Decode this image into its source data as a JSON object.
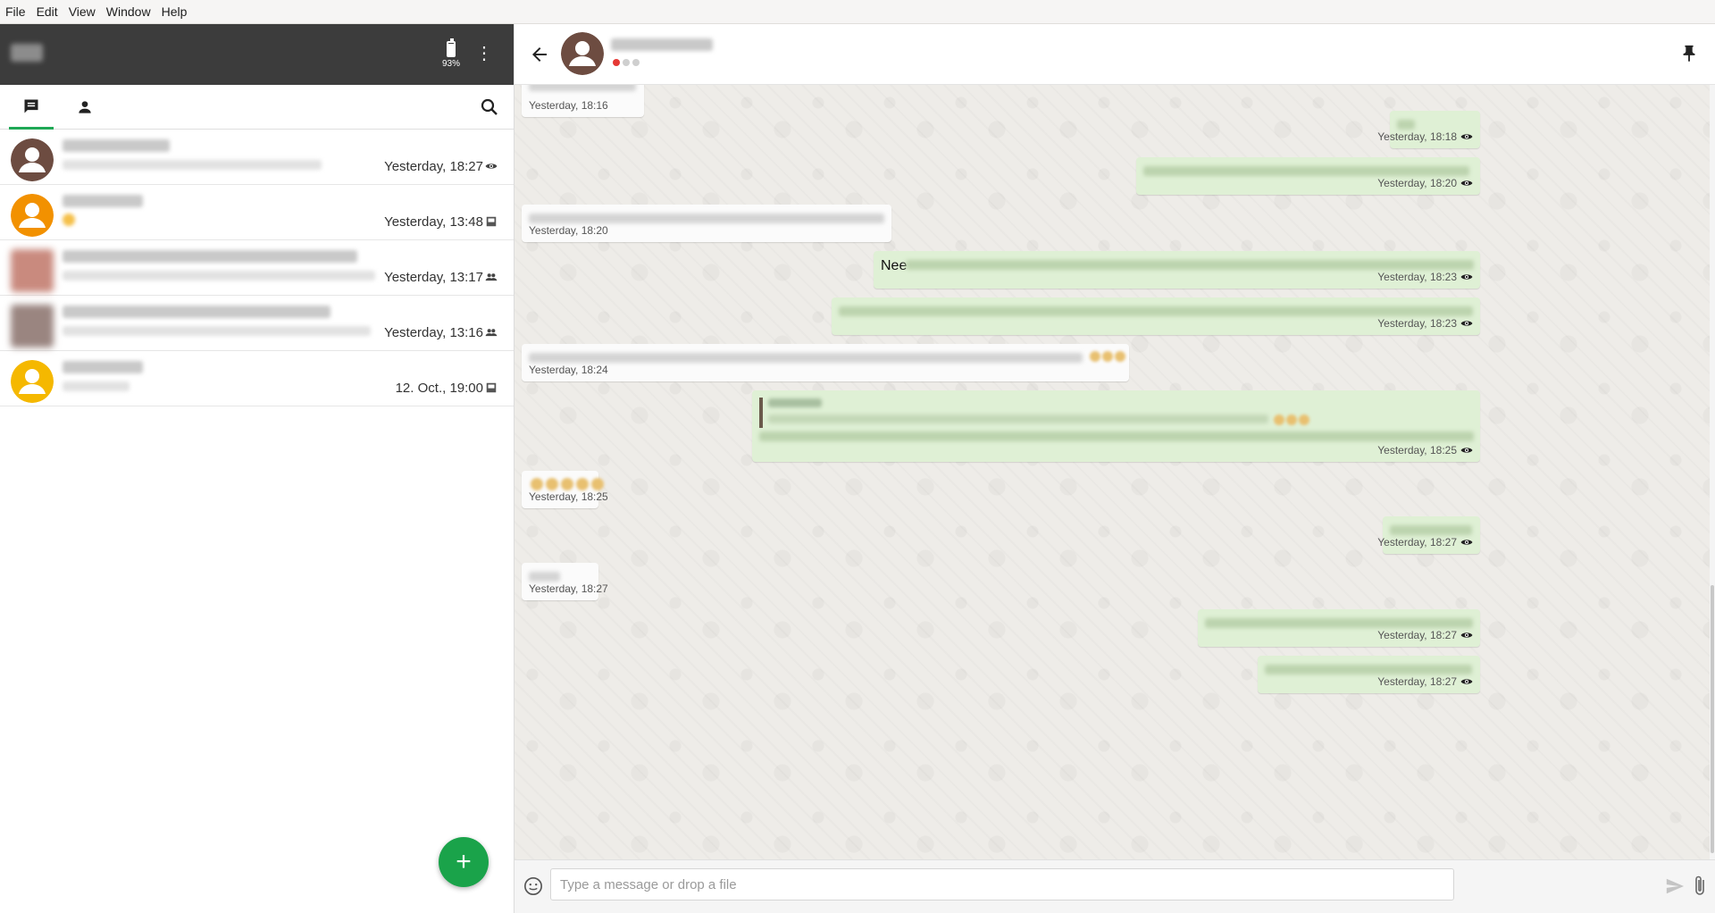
{
  "menubar": {
    "items": [
      "File",
      "Edit",
      "View",
      "Window",
      "Help"
    ]
  },
  "sidebar": {
    "battery_label": "93%",
    "battery_level": 0.93,
    "kebab_glyph": "⋮",
    "conversations": [
      {
        "time": "Yesterday, 18:27",
        "status": "seen",
        "avatar_color": "#6d4c41"
      },
      {
        "time": "Yesterday, 13:48",
        "status": "sent",
        "avatar_color": "#f29100"
      },
      {
        "time": "Yesterday, 13:17",
        "status": "group",
        "avatar_color": "#c98a7e"
      },
      {
        "time": "Yesterday, 13:16",
        "status": "group",
        "avatar_color": "#9a8580"
      },
      {
        "time": "12. Oct., 19:00",
        "status": "sent",
        "avatar_color": "#f5b800"
      }
    ],
    "fab_label": "+"
  },
  "chat": {
    "presence": [
      "online",
      "idle",
      "idle"
    ],
    "messages": [
      {
        "dir": "in",
        "time": "Yesterday, 18:16"
      },
      {
        "dir": "out",
        "time": "Yesterday, 18:18"
      },
      {
        "dir": "out",
        "time": "Yesterday, 18:20"
      },
      {
        "dir": "in",
        "time": "Yesterday, 18:20"
      },
      {
        "dir": "out",
        "visible_text": "Nee",
        "time": "Yesterday, 18:23"
      },
      {
        "dir": "out",
        "time": "Yesterday, 18:23"
      },
      {
        "dir": "in",
        "time": "Yesterday, 18:24"
      },
      {
        "dir": "out",
        "time": "Yesterday, 18:25"
      },
      {
        "dir": "in",
        "time": "Yesterday, 18:25"
      },
      {
        "dir": "out",
        "time": "Yesterday, 18:27"
      },
      {
        "dir": "in",
        "time": "Yesterday, 18:27"
      },
      {
        "dir": "out",
        "time": "Yesterday, 18:27"
      },
      {
        "dir": "out",
        "time": "Yesterday, 18:27"
      }
    ]
  },
  "composer": {
    "placeholder": "Type a message or drop a file"
  },
  "colors": {
    "accent": "#1fa855",
    "outgoing_bubble": "#dff0d5",
    "incoming_bubble": "#fbfbfb",
    "header_dark": "#3c3c3c"
  }
}
